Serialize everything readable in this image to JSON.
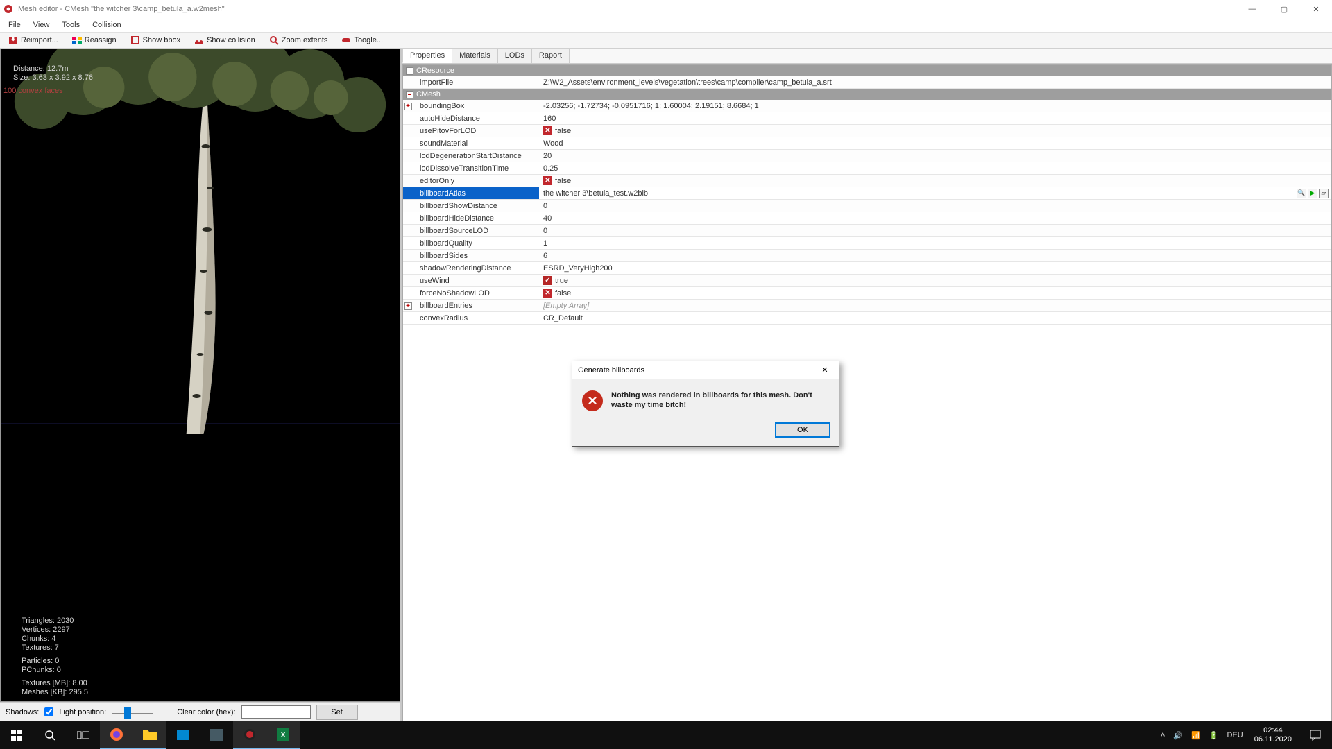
{
  "app": {
    "title": "Mesh editor - CMesh \"the witcher 3\\camp_betula_a.w2mesh\""
  },
  "menu": [
    "File",
    "View",
    "Tools",
    "Collision"
  ],
  "toolbar": [
    {
      "icon": "reimport",
      "label": "Reimport..."
    },
    {
      "icon": "reassign",
      "label": "Reassign"
    },
    {
      "icon": "bbox",
      "label": "Show bbox"
    },
    {
      "icon": "collision",
      "label": "Show collision"
    },
    {
      "icon": "zoom",
      "label": "Zoom extents"
    },
    {
      "icon": "toggle",
      "label": "Toogle..."
    }
  ],
  "viewport": {
    "distance": "Distance: 12.7m",
    "size": "Size: 3.63 x 3.92 x 8.76",
    "convex": "100 convex faces",
    "stats": [
      "Triangles: 2030",
      "Vertices: 2297",
      "Chunks: 4",
      "Textures: 7",
      "",
      "Particles: 0",
      "PChunks: 0",
      "",
      "Textures [MB]: 8.00",
      "Meshes [KB]: 295.5"
    ]
  },
  "bottom": {
    "shadows_label": "Shadows:",
    "lightpos_label": "Light position:",
    "clearcolor_label": "Clear color (hex):",
    "clearcolor_value": "",
    "set_label": "Set"
  },
  "tabs": [
    "Properties",
    "Materials",
    "LODs",
    "Raport"
  ],
  "prop_headers": {
    "cresource": "CResource",
    "cmesh": "CMesh"
  },
  "props": {
    "importFile": {
      "name": "importFile",
      "value": "Z:\\W2_Assets\\environment_levels\\vegetation\\trees\\camp\\compiler\\camp_betula_a.srt"
    },
    "boundingBox": {
      "name": "boundingBox",
      "value": "-2.03256; -1.72734; -0.0951716; 1; 1.60004; 2.19151; 8.6684; 1",
      "expand": true
    },
    "autoHideDistance": {
      "name": "autoHideDistance",
      "value": "160"
    },
    "usePitovForLOD": {
      "name": "usePitovForLOD",
      "value": "false",
      "bool": "x"
    },
    "soundMaterial": {
      "name": "soundMaterial",
      "value": "Wood"
    },
    "lodDegenerationStartDistance": {
      "name": "lodDegenerationStartDistance",
      "value": "20"
    },
    "lodDissolveTransitionTime": {
      "name": "lodDissolveTransitionTime",
      "value": "0.25"
    },
    "editorOnly": {
      "name": "editorOnly",
      "value": "false",
      "bool": "x"
    },
    "billboardAtlas": {
      "name": "billboardAtlas",
      "value": "the witcher 3\\betula_test.w2blb",
      "selected": true,
      "buttons": true
    },
    "billboardShowDistance": {
      "name": "billboardShowDistance",
      "value": "0"
    },
    "billboardHideDistance": {
      "name": "billboardHideDistance",
      "value": "40"
    },
    "billboardSourceLOD": {
      "name": "billboardSourceLOD",
      "value": "0"
    },
    "billboardQuality": {
      "name": "billboardQuality",
      "value": "1"
    },
    "billboardSides": {
      "name": "billboardSides",
      "value": "6"
    },
    "shadowRenderingDistance": {
      "name": "shadowRenderingDistance",
      "value": "ESRD_VeryHigh200"
    },
    "useWind": {
      "name": "useWind",
      "value": "true",
      "bool": "v"
    },
    "forceNoShadowLOD": {
      "name": "forceNoShadowLOD",
      "value": "false",
      "bool": "x"
    },
    "billboardEntries": {
      "name": "billboardEntries",
      "value": "[Empty Array]",
      "empty": true,
      "expand": true
    },
    "convexRadius": {
      "name": "convexRadius",
      "value": "CR_Default"
    }
  },
  "dialog": {
    "title": "Generate billboards",
    "message": "Nothing was rendered in billboards for this mesh. Don't waste my time bitch!",
    "ok": "OK"
  },
  "taskbar": {
    "time": "02:44",
    "date": "06.11.2020",
    "lang": "DEU"
  }
}
